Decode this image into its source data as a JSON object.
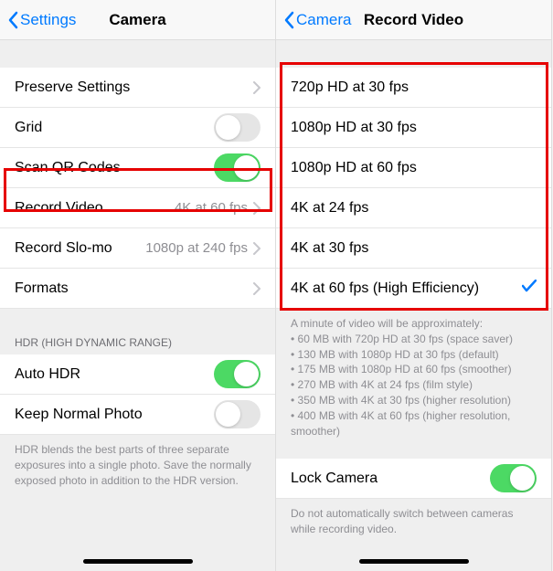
{
  "left": {
    "back": "Settings",
    "title": "Camera",
    "rows": {
      "preserve": "Preserve Settings",
      "grid": "Grid",
      "scanqr": "Scan QR Codes",
      "recordVideo": "Record Video",
      "recordVideoValue": "4K at 60 fps",
      "recordSlomo": "Record Slo-mo",
      "recordSlomoValue": "1080p at 240 fps",
      "formats": "Formats"
    },
    "hdrHeader": "HDR (HIGH DYNAMIC RANGE)",
    "autoHdr": "Auto HDR",
    "keepNormal": "Keep Normal Photo",
    "hdrFooter": "HDR blends the best parts of three separate exposures into a single photo. Save the normally exposed photo in addition to the HDR version."
  },
  "right": {
    "back": "Camera",
    "title": "Record Video",
    "options": {
      "o1": "720p HD at 30 fps",
      "o2": "1080p HD at 30 fps",
      "o3": "1080p HD at 60 fps",
      "o4": "4K at 24 fps",
      "o5": "4K at 30 fps",
      "o6": "4K at 60 fps (High Efficiency)"
    },
    "footerIntro": "A minute of video will be approximately:",
    "footer": {
      "b1": "60 MB with 720p HD at 30 fps (space saver)",
      "b2": "130 MB with 1080p HD at 30 fps (default)",
      "b3": "175 MB with 1080p HD at 60 fps (smoother)",
      "b4": "270 MB with 4K at 24 fps (film style)",
      "b5": "350 MB with 4K at 30 fps (higher resolution)",
      "b6": "400 MB with 4K at 60 fps (higher resolution, smoother)"
    },
    "lockCamera": "Lock Camera",
    "lockFooter": "Do not automatically switch between cameras while recording video."
  }
}
